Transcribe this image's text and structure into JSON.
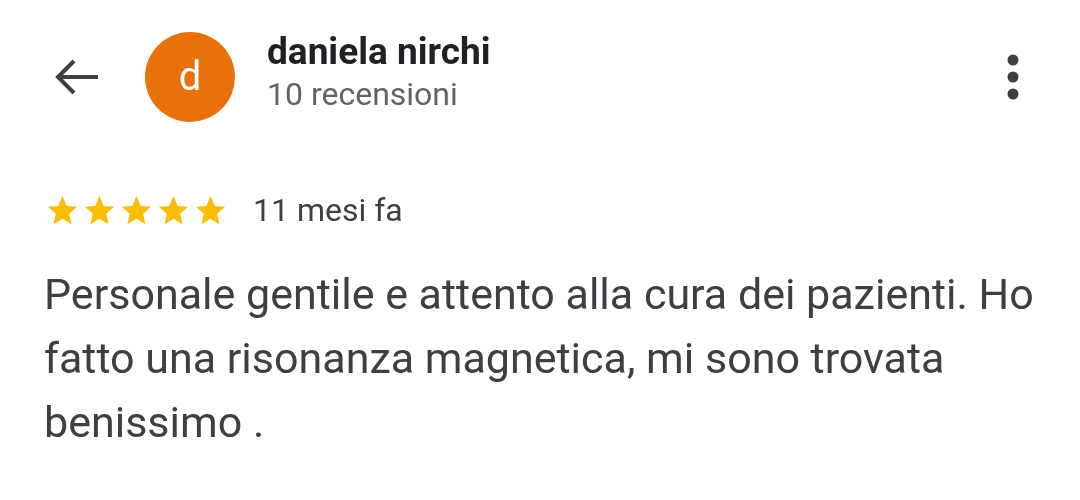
{
  "reviewer": {
    "avatar_letter": "d",
    "name": "daniela nirchi",
    "review_count": "10 recensioni"
  },
  "review": {
    "stars": 5,
    "time": "11 mesi fa",
    "text": "Personale gentile e attento alla cura dei pazienti. Ho fatto una risonanza magnetica, mi sono trovata benissimo ."
  }
}
